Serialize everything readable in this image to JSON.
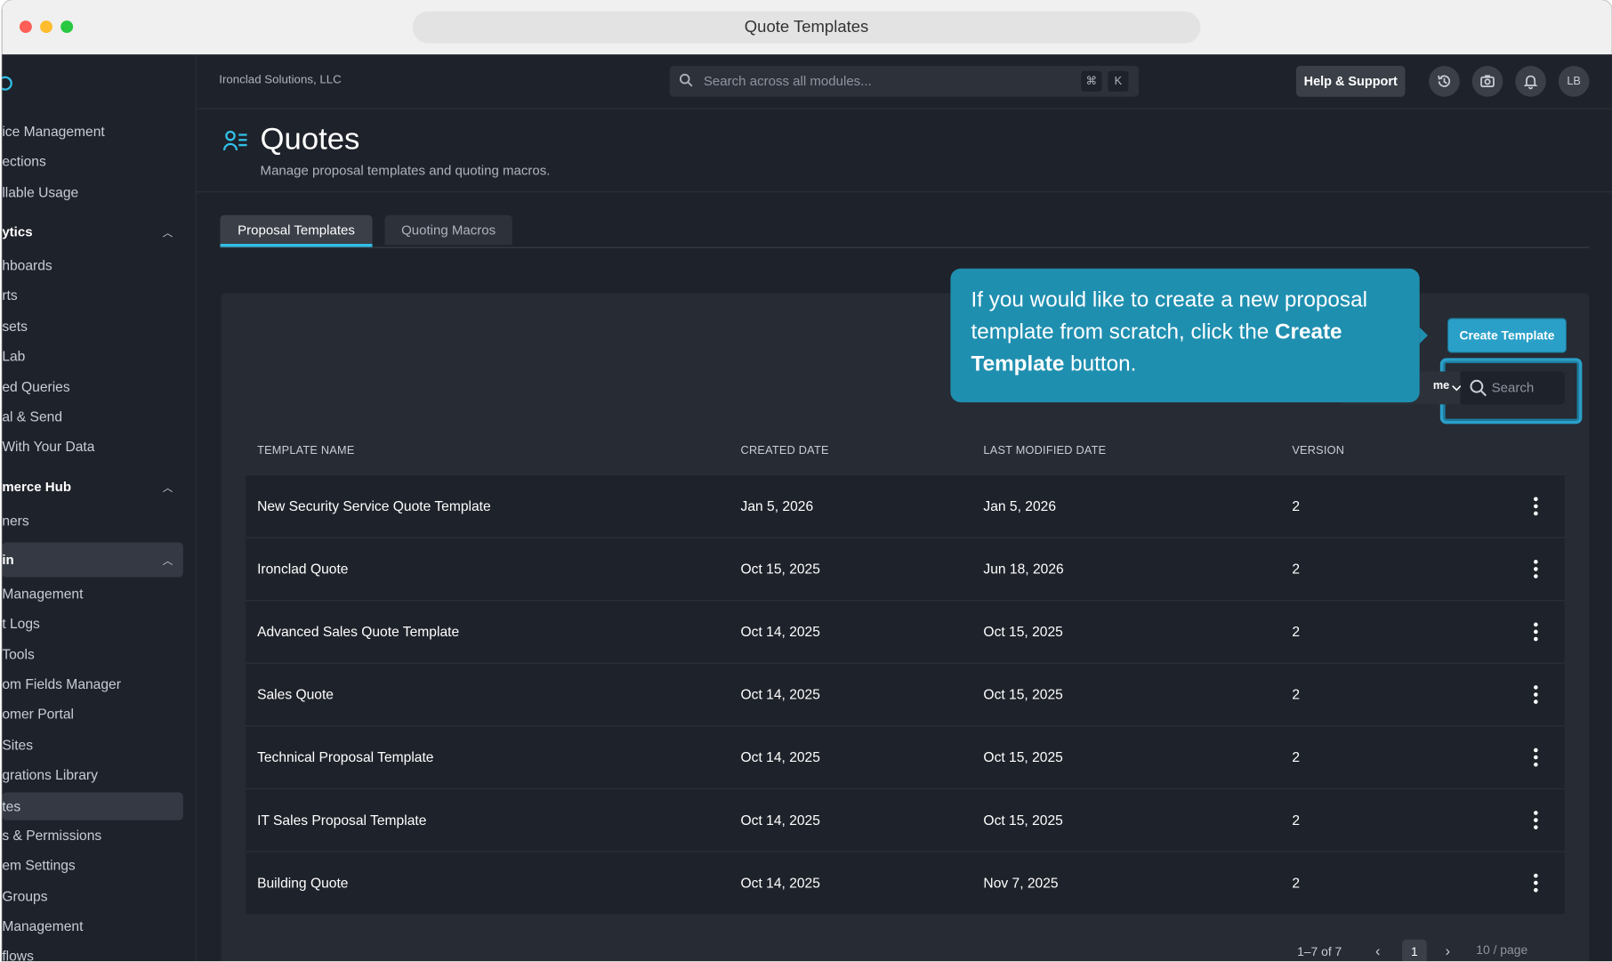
{
  "window": {
    "title": "Quote Templates"
  },
  "sidebar": {
    "items": [
      {
        "label": "ice Management"
      },
      {
        "label": "ections"
      },
      {
        "label": "llable Usage"
      },
      {
        "label": "ytics"
      },
      {
        "label": "hboards"
      },
      {
        "label": "rts"
      },
      {
        "label": "sets"
      },
      {
        "label": "Lab"
      },
      {
        "label": "ed Queries"
      },
      {
        "label": "al & Send"
      },
      {
        "label": "With Your Data"
      },
      {
        "label": "merce Hub"
      },
      {
        "label": "ners"
      },
      {
        "label": "in"
      },
      {
        "label": "Management"
      },
      {
        "label": "t Logs"
      },
      {
        "label": "Tools"
      },
      {
        "label": "om Fields Manager"
      },
      {
        "label": "omer Portal"
      },
      {
        "label": "Sites"
      },
      {
        "label": "grations Library"
      },
      {
        "label": "tes"
      },
      {
        "label": "s & Permissions"
      },
      {
        "label": "em Settings"
      },
      {
        "label": "Groups"
      },
      {
        "label": "Management"
      },
      {
        "label": "flows"
      }
    ]
  },
  "topbar": {
    "org": "Ironclad Solutions, LLC",
    "search_placeholder": "Search across all modules...",
    "kbd_cmd": "⌘",
    "kbd_k": "K",
    "help": "Help & Support",
    "avatar": "LB"
  },
  "page": {
    "title": "Quotes",
    "subtitle": "Manage proposal templates and quoting macros."
  },
  "tabs": [
    {
      "label": "Proposal Templates"
    },
    {
      "label": "Quoting Macros"
    }
  ],
  "toolbar": {
    "create_label": "Create Template",
    "sort_label": "me",
    "search_placeholder": "Search"
  },
  "table": {
    "columns": [
      "TEMPLATE NAME",
      "CREATED DATE",
      "LAST MODIFIED DATE",
      "VERSION"
    ],
    "rows": [
      {
        "name": "New Security Service Quote Template",
        "created": "Jan 5, 2026",
        "modified": "Jan 5, 2026",
        "version": "2"
      },
      {
        "name": "Ironclad Quote",
        "created": "Oct 15, 2025",
        "modified": "Jun 18, 2026",
        "version": "2"
      },
      {
        "name": "Advanced Sales Quote Template",
        "created": "Oct 14, 2025",
        "modified": "Oct 15, 2025",
        "version": "2"
      },
      {
        "name": "Sales Quote",
        "created": "Oct 14, 2025",
        "modified": "Oct 15, 2025",
        "version": "2"
      },
      {
        "name": "Technical Proposal Template",
        "created": "Oct 14, 2025",
        "modified": "Oct 15, 2025",
        "version": "2"
      },
      {
        "name": "IT Sales Proposal Template",
        "created": "Oct 14, 2025",
        "modified": "Oct 15, 2025",
        "version": "2"
      },
      {
        "name": "Building Quote",
        "created": "Oct 14, 2025",
        "modified": "Nov 7, 2025",
        "version": "2"
      }
    ]
  },
  "pagination": {
    "range": "1–7 of 7",
    "current": "1",
    "per_page": "10 / page"
  },
  "tooltip": {
    "before": "If you would like to create a new proposal template from scratch, click the ",
    "bold": "Create Template",
    "after": " button."
  },
  "colors": {
    "accent": "#31c0e8",
    "tooltip": "#1f8fb0",
    "bg": "#1e222a",
    "panel": "#272b33"
  }
}
